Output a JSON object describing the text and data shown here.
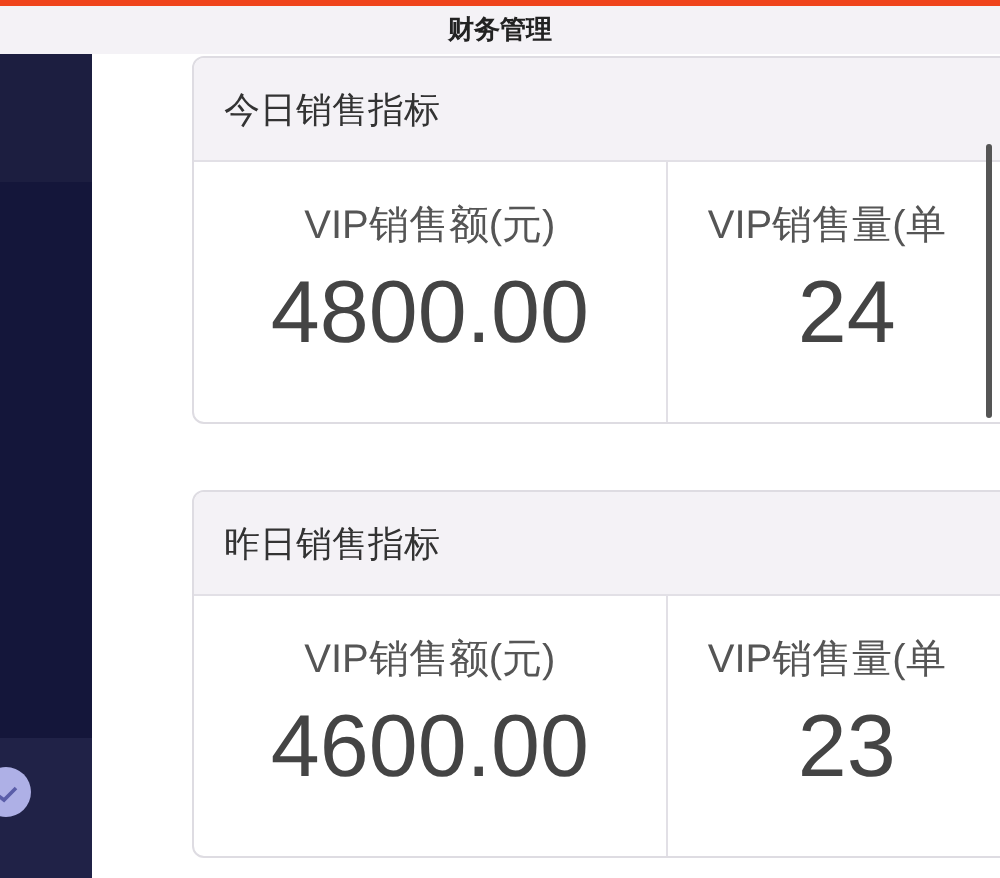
{
  "window": {
    "title": "财务管理"
  },
  "cards": [
    {
      "title": "今日销售指标",
      "metrics": [
        {
          "label": "VIP销售额(元)",
          "value": "4800.00"
        },
        {
          "label": "VIP销售量(单",
          "value": "24"
        }
      ]
    },
    {
      "title": "昨日销售指标",
      "metrics": [
        {
          "label": "VIP销售额(元)",
          "value": "4600.00"
        },
        {
          "label": "VIP销售量(单",
          "value": "23"
        }
      ]
    }
  ]
}
